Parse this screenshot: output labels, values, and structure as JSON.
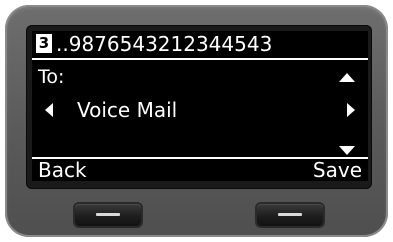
{
  "display": {
    "line_number": "3",
    "title": "..9876543212344543",
    "field_label": "To:",
    "field_value": "Voice Mail"
  },
  "softkeys": {
    "left": "Back",
    "right": "Save"
  },
  "icons": {
    "up": "triangle-up-icon",
    "down": "triangle-down-icon",
    "left": "triangle-left-icon",
    "right": "triangle-right-icon"
  },
  "colors": {
    "screen_bg": "#000000",
    "screen_text": "#ffffff",
    "device_body": "#5f5f5f"
  }
}
